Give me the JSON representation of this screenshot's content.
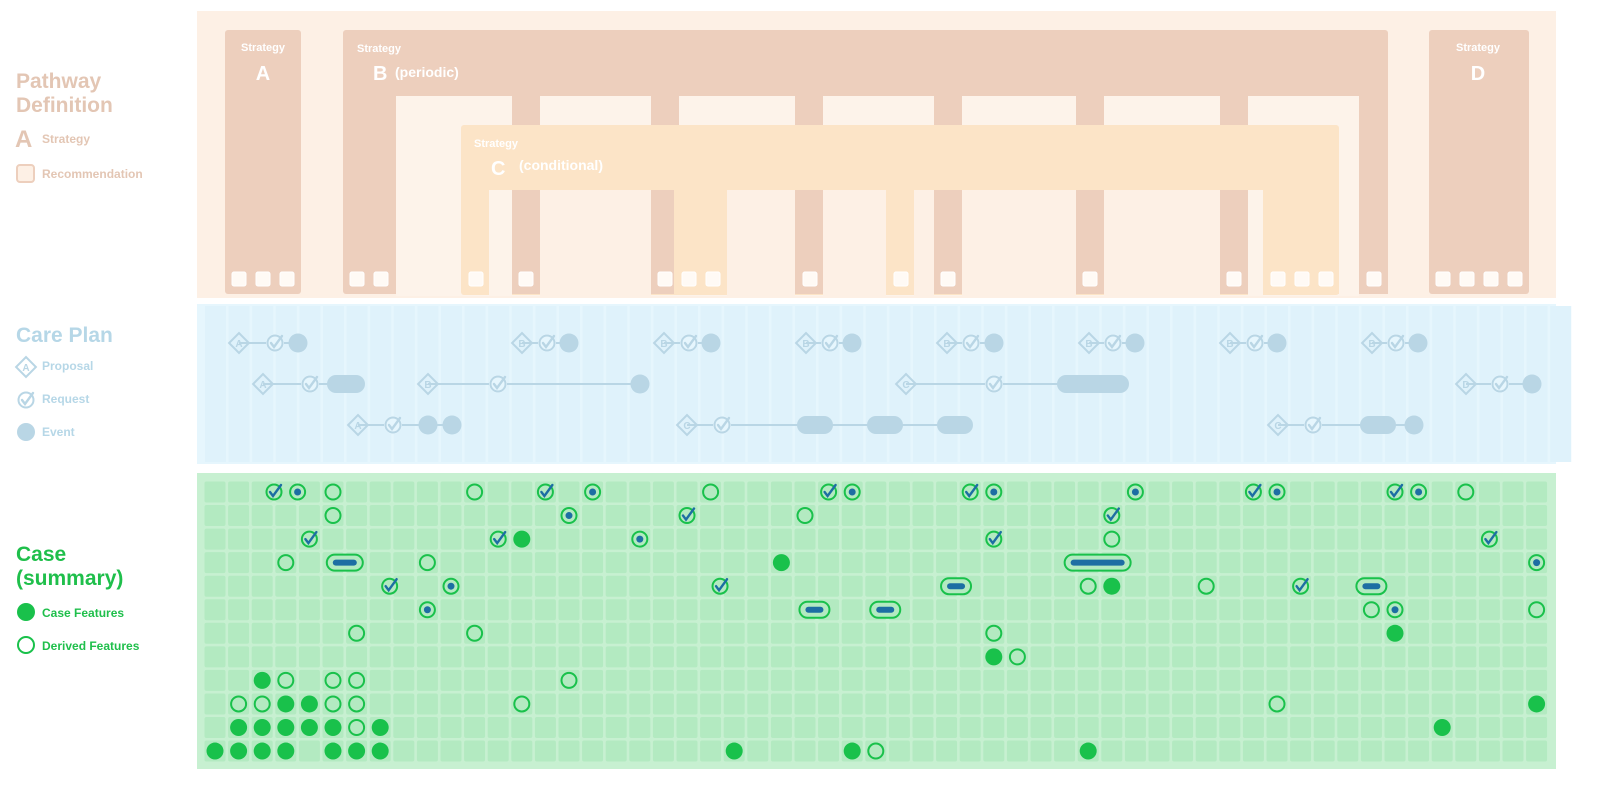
{
  "colors": {
    "pathway_bg": "#fdf0e5",
    "strategy_fill": "#edcfbd",
    "strategy_c_fill": "#fce4c7",
    "careplan_bg": "#e6f6fd",
    "careplan_mark": "#b9d6e5",
    "case_bg": "#c7f0d1",
    "case_cell": "#b3eac1",
    "case_green": "#19c14b",
    "case_blue": "#1d6ea3"
  },
  "legend": {
    "pathway": {
      "title_1": "Pathway",
      "title_2": "Definition",
      "strategy_glyph": "A",
      "strategy": "Strategy",
      "recommendation": "Recommendation"
    },
    "careplan": {
      "title": "Care Plan",
      "proposal_glyph": "A",
      "proposal": "Proposal",
      "request": "Request",
      "event": "Event"
    },
    "case": {
      "title_1": "Case",
      "title_2": "(summary)",
      "case_features": "Case Features",
      "derived_features": "Derived Features"
    }
  },
  "pathway": {
    "strategy_word": "Strategy",
    "strategies": [
      {
        "letter": "A",
        "suffix": ""
      },
      {
        "letter": "B",
        "suffix": "(periodic)"
      },
      {
        "letter": "C",
        "suffix": "(conditional)"
      },
      {
        "letter": "D",
        "suffix": ""
      }
    ]
  },
  "careplan": {
    "rows": [
      [
        {
          "kind": "proposal",
          "label": "A"
        },
        {
          "kind": "request"
        },
        {
          "kind": "event"
        },
        {
          "kind": "proposal",
          "label": "B"
        },
        {
          "kind": "request"
        },
        {
          "kind": "event"
        },
        {
          "kind": "proposal",
          "label": "B"
        },
        {
          "kind": "request"
        },
        {
          "kind": "event"
        },
        {
          "kind": "proposal",
          "label": "B"
        },
        {
          "kind": "request"
        },
        {
          "kind": "event"
        },
        {
          "kind": "proposal",
          "label": "B"
        },
        {
          "kind": "request"
        },
        {
          "kind": "event"
        },
        {
          "kind": "proposal",
          "label": "B"
        },
        {
          "kind": "request"
        },
        {
          "kind": "event"
        },
        {
          "kind": "proposal",
          "label": "B"
        },
        {
          "kind": "request"
        },
        {
          "kind": "event"
        },
        {
          "kind": "proposal",
          "label": "B"
        },
        {
          "kind": "request"
        },
        {
          "kind": "event"
        }
      ],
      [
        {
          "kind": "proposal",
          "label": "A"
        },
        {
          "kind": "request"
        },
        {
          "kind": "event"
        },
        {
          "kind": "proposal",
          "label": "B"
        },
        {
          "kind": "request"
        },
        {
          "kind": "event"
        },
        {
          "kind": "proposal",
          "label": "C"
        },
        {
          "kind": "request"
        },
        {
          "kind": "event"
        },
        {
          "kind": "proposal",
          "label": "D"
        },
        {
          "kind": "request"
        },
        {
          "kind": "event"
        }
      ],
      [
        {
          "kind": "proposal",
          "label": "A"
        },
        {
          "kind": "request"
        },
        {
          "kind": "event"
        },
        {
          "kind": "event"
        },
        {
          "kind": "proposal",
          "label": "C"
        },
        {
          "kind": "request"
        },
        {
          "kind": "event"
        },
        {
          "kind": "event"
        },
        {
          "kind": "event"
        },
        {
          "kind": "proposal",
          "label": "C"
        },
        {
          "kind": "request"
        },
        {
          "kind": "event"
        },
        {
          "kind": "event"
        }
      ]
    ]
  },
  "case": {
    "grid_rows": 12,
    "marker_kinds": [
      "case-feature",
      "derived-feature",
      "request",
      "derived-event",
      "derived-interval"
    ],
    "markers": [
      {
        "row": 0,
        "kind": "request"
      },
      {
        "row": 0,
        "kind": "derived-event"
      },
      {
        "row": 0,
        "kind": "derived-feature"
      },
      {
        "row": 0,
        "kind": "derived-feature"
      },
      {
        "row": 0,
        "kind": "request"
      },
      {
        "row": 0,
        "kind": "derived-event"
      },
      {
        "row": 0,
        "kind": "derived-feature"
      },
      {
        "row": 0,
        "kind": "request"
      },
      {
        "row": 0,
        "kind": "derived-event"
      },
      {
        "row": 0,
        "kind": "request"
      },
      {
        "row": 0,
        "kind": "derived-event"
      },
      {
        "row": 0,
        "kind": "derived-event"
      },
      {
        "row": 0,
        "kind": "request"
      },
      {
        "row": 0,
        "kind": "derived-event"
      },
      {
        "row": 0,
        "kind": "request"
      },
      {
        "row": 0,
        "kind": "derived-event"
      },
      {
        "row": 0,
        "kind": "derived-feature"
      },
      {
        "row": 1,
        "kind": "derived-feature"
      },
      {
        "row": 1,
        "kind": "derived-event"
      },
      {
        "row": 1,
        "kind": "request"
      },
      {
        "row": 1,
        "kind": "derived-feature"
      },
      {
        "row": 1,
        "kind": "request"
      },
      {
        "row": 2,
        "kind": "request"
      },
      {
        "row": 2,
        "kind": "request"
      },
      {
        "row": 2,
        "kind": "case-feature"
      },
      {
        "row": 2,
        "kind": "derived-event"
      },
      {
        "row": 2,
        "kind": "request"
      },
      {
        "row": 2,
        "kind": "derived-feature"
      },
      {
        "row": 2,
        "kind": "request"
      },
      {
        "row": 3,
        "kind": "derived-feature"
      },
      {
        "row": 3,
        "kind": "derived-interval"
      },
      {
        "row": 3,
        "kind": "derived-feature"
      },
      {
        "row": 3,
        "kind": "case-feature"
      },
      {
        "row": 3,
        "kind": "derived-interval"
      },
      {
        "row": 3,
        "kind": "derived-event"
      },
      {
        "row": 4,
        "kind": "request"
      },
      {
        "row": 4,
        "kind": "derived-event"
      },
      {
        "row": 4,
        "kind": "request"
      },
      {
        "row": 4,
        "kind": "derived-interval"
      },
      {
        "row": 4,
        "kind": "derived-feature"
      },
      {
        "row": 4,
        "kind": "case-feature"
      },
      {
        "row": 4,
        "kind": "derived-feature"
      },
      {
        "row": 4,
        "kind": "request"
      },
      {
        "row": 4,
        "kind": "derived-interval"
      },
      {
        "row": 5,
        "kind": "derived-event"
      },
      {
        "row": 5,
        "kind": "derived-interval"
      },
      {
        "row": 5,
        "kind": "derived-interval"
      },
      {
        "row": 5,
        "kind": "derived-feature"
      },
      {
        "row": 5,
        "kind": "derived-event"
      },
      {
        "row": 5,
        "kind": "derived-feature"
      },
      {
        "row": 6,
        "kind": "derived-feature"
      },
      {
        "row": 6,
        "kind": "derived-feature"
      },
      {
        "row": 6,
        "kind": "derived-feature"
      },
      {
        "row": 6,
        "kind": "case-feature"
      },
      {
        "row": 7,
        "kind": "case-feature"
      },
      {
        "row": 7,
        "kind": "derived-feature"
      },
      {
        "row": 8,
        "kind": "case-feature"
      },
      {
        "row": 8,
        "kind": "derived-feature"
      },
      {
        "row": 8,
        "kind": "derived-feature"
      },
      {
        "row": 8,
        "kind": "derived-feature"
      },
      {
        "row": 8,
        "kind": "derived-feature"
      },
      {
        "row": 9,
        "kind": "derived-feature"
      },
      {
        "row": 9,
        "kind": "derived-feature"
      },
      {
        "row": 9,
        "kind": "case-feature"
      },
      {
        "row": 9,
        "kind": "case-feature"
      },
      {
        "row": 9,
        "kind": "derived-feature"
      },
      {
        "row": 9,
        "kind": "derived-feature"
      },
      {
        "row": 9,
        "kind": "derived-feature"
      },
      {
        "row": 9,
        "kind": "derived-feature"
      },
      {
        "row": 9,
        "kind": "case-feature"
      },
      {
        "row": 10,
        "kind": "case-feature"
      },
      {
        "row": 10,
        "kind": "case-feature"
      },
      {
        "row": 10,
        "kind": "case-feature"
      },
      {
        "row": 10,
        "kind": "case-feature"
      },
      {
        "row": 10,
        "kind": "case-feature"
      },
      {
        "row": 10,
        "kind": "derived-feature"
      },
      {
        "row": 10,
        "kind": "case-feature"
      },
      {
        "row": 10,
        "kind": "case-feature"
      },
      {
        "row": 11,
        "kind": "case-feature"
      },
      {
        "row": 11,
        "kind": "case-feature"
      },
      {
        "row": 11,
        "kind": "case-feature"
      },
      {
        "row": 11,
        "kind": "case-feature"
      },
      {
        "row": 11,
        "kind": "case-feature"
      },
      {
        "row": 11,
        "kind": "case-feature"
      },
      {
        "row": 11,
        "kind": "case-feature"
      },
      {
        "row": 11,
        "kind": "case-feature"
      },
      {
        "row": 11,
        "kind": "case-feature"
      },
      {
        "row": 11,
        "kind": "derived-feature"
      },
      {
        "row": 11,
        "kind": "case-feature"
      }
    ]
  }
}
